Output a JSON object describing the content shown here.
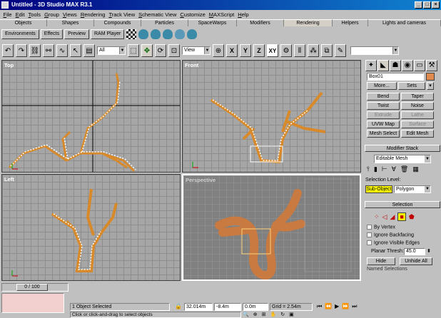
{
  "window": {
    "title": "Untitled - 3D Studio MAX R3.1"
  },
  "menu": [
    "File",
    "Edit",
    "Tools",
    "Group",
    "Views",
    "Rendering",
    "Track View",
    "Schematic View",
    "Customize",
    "MAXScript",
    "Help"
  ],
  "tabs": [
    "Objects",
    "Shapes",
    "Compounds",
    "Particles",
    "SpaceWarps",
    "Modifiers",
    "Rendering",
    "Helpers",
    "Lights and cameras"
  ],
  "active_tab": "Rendering",
  "tab_tools": {
    "environments": "Environments",
    "effects": "Effects",
    "preview": "Preview",
    "ram_player": "RAM Player"
  },
  "toolbar": {
    "selection_filter": "All",
    "ref_coord": "View",
    "axis_xy": "XY"
  },
  "viewports": {
    "top": "Top",
    "front": "Front",
    "left": "Left",
    "perspective": "Perspective"
  },
  "command_panel": {
    "object_name": "Box01",
    "object_color": "#e08a50",
    "more": "More...",
    "sets": "Sets",
    "modifiers": [
      "Bend",
      "Taper",
      "Twist",
      "Noise",
      "Extrude",
      "Lathe",
      "UVW Map",
      "Surface",
      "Mesh Select",
      "Edit Mesh"
    ],
    "modifier_stack_title": "Modifier Stack",
    "stack_value": "Editable Mesh",
    "selection_level_label": "Selection Level:",
    "sub_object": "Sub-Object",
    "sub_level": "Polygon",
    "selection_title": "Selection",
    "by_vertex": "By Vertex",
    "ignore_backfacing": "Ignore Backfacing",
    "ignore_visible_edges": "Ignore Visible Edges",
    "planar_thresh_label": "Planar Thresh:",
    "planar_thresh_value": "45.0",
    "hide": "Hide",
    "unhide_all": "Unhide All",
    "named_selections": "Named Selections"
  },
  "status": {
    "frame": "0 / 100",
    "selected": "1 Object Selected",
    "prompt": "Click or click-and-drag to select objects",
    "x": "32.014m",
    "y": "-8.4m",
    "z": "0.0m",
    "grid": "Grid = 2.54m"
  }
}
